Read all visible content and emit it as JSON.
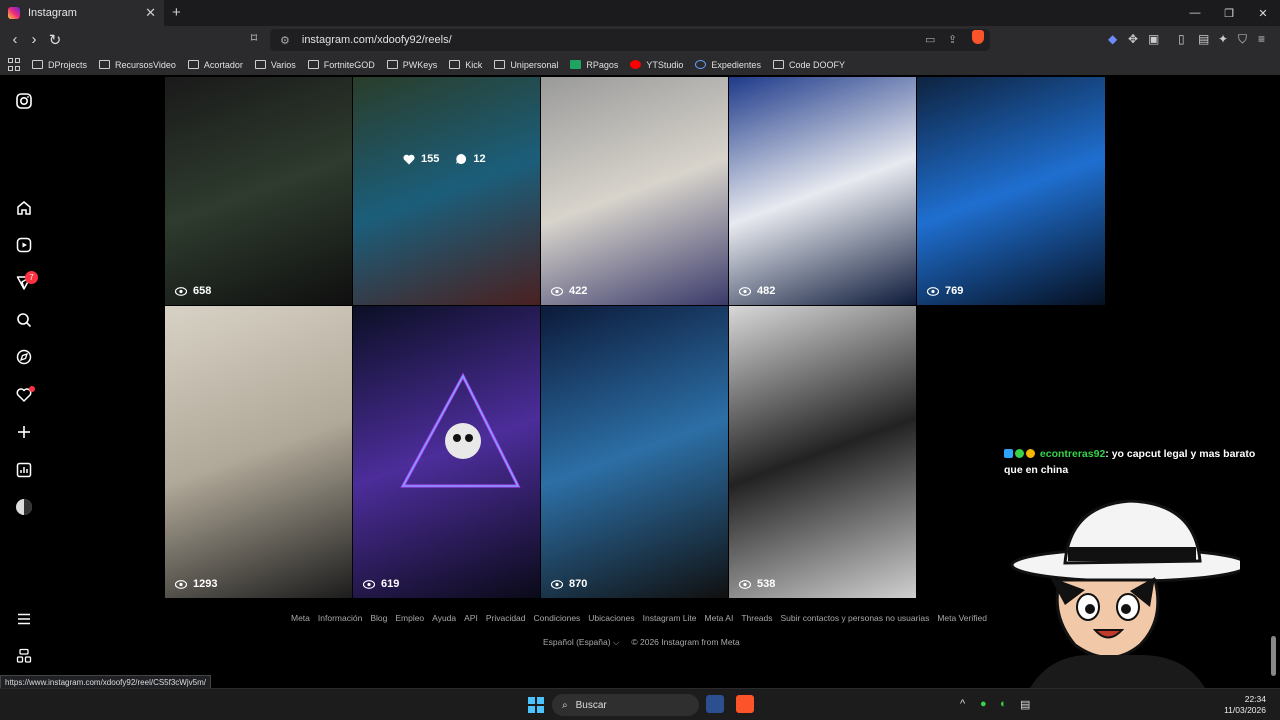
{
  "browser": {
    "tab_title": "Instagram",
    "tab_close": "✕",
    "new_tab": "+",
    "url": "instagram.com/xdoofy92/reels/",
    "bookmarks": [
      "DProjects",
      "RecursosVideo",
      "Acortador",
      "Varios",
      "FortniteGOD",
      "PWKeys",
      "Kick",
      "Unipersonal",
      "RPagos",
      "YTStudio",
      "Expedientes",
      "Code DOOFY"
    ],
    "window_controls": [
      "—",
      "❐",
      "✕"
    ]
  },
  "sidebar": {
    "items": [
      "instagram-icon",
      "home-icon",
      "reels-icon",
      "messages-icon",
      "search-icon",
      "explore-icon",
      "notifications-icon",
      "create-icon",
      "dashboard-icon",
      "profile-icon",
      "menu-icon",
      "meta-icon"
    ],
    "messages_badge": "7"
  },
  "reels": [
    {
      "views": "658",
      "colors": [
        "#1a1a1a",
        "#2e3b2e",
        "#0f0f0f"
      ]
    },
    {
      "views": "",
      "likes": "155",
      "comments": "12",
      "colors": [
        "#2a3d2a",
        "#1b5e7a",
        "#4a2020"
      ]
    },
    {
      "views": "422",
      "colors": [
        "#9a9a9a",
        "#d8d4cc",
        "#3a3a6a"
      ]
    },
    {
      "views": "482",
      "colors": [
        "#1e3a8a",
        "#e8eaf0",
        "#0d1a3a"
      ]
    },
    {
      "views": "769",
      "colors": [
        "#0e2340",
        "#1f6fd0",
        "#061020"
      ]
    },
    {
      "views": "1293",
      "colors": [
        "#d8d2c6",
        "#b0a898",
        "#1c1c1c"
      ]
    },
    {
      "views": "619",
      "colors": [
        "#0b0f25",
        "#4c2d9a",
        "#0a0a18"
      ]
    },
    {
      "views": "870",
      "colors": [
        "#0c1a3a",
        "#2c6fa6",
        "#101010"
      ]
    },
    {
      "views": "538",
      "colors": [
        "#d8d8d8",
        "#222",
        "#cfcfcf"
      ]
    }
  ],
  "hover": {
    "likes_label": "155",
    "comments_label": "12"
  },
  "footer": {
    "links": [
      "Meta",
      "Información",
      "Blog",
      "Empleo",
      "Ayuda",
      "API",
      "Privacidad",
      "Condiciones",
      "Ubicaciones",
      "Instagram Lite",
      "Meta AI",
      "Threads",
      "Subir contactos y personas no usuarias",
      "Meta Verified"
    ],
    "language": "Español (España) ⌵",
    "copyright": "© 2026 Instagram from Meta"
  },
  "status_url": "https://www.instagram.com/xdoofy92/reel/CS5f3cWjv5m/",
  "chat": {
    "user": "econtreras92",
    "message": ": yo capcut legal y mas barato que en china"
  },
  "taskbar": {
    "search_placeholder": "Buscar",
    "time": "22:34",
    "date": "11/03/2026"
  },
  "colors": {
    "accent": "#4cc2ff",
    "badge": "#ff3040",
    "chat_user": "#37d24a"
  }
}
